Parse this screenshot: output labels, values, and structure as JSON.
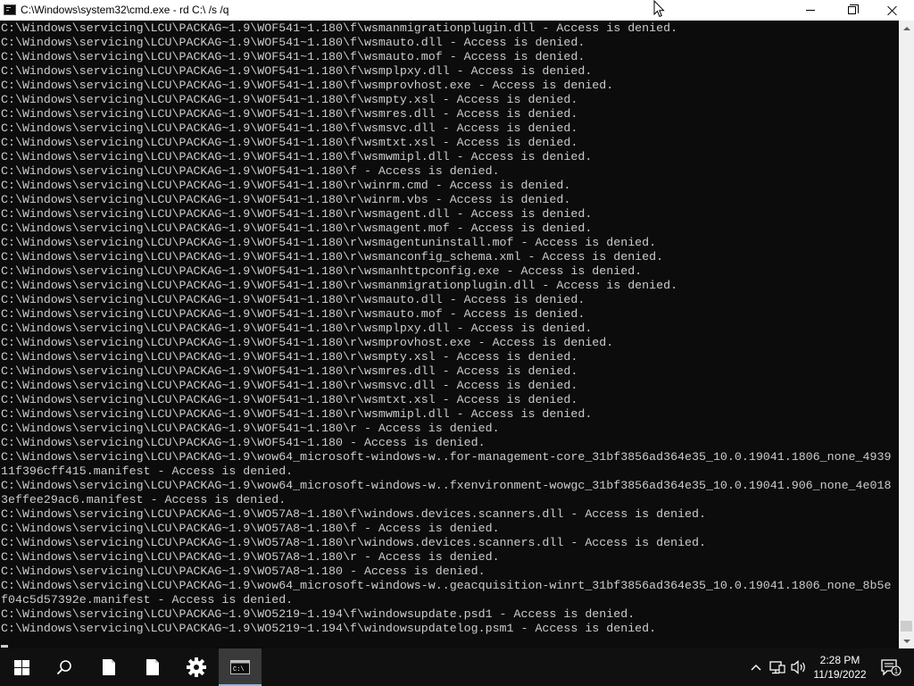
{
  "window": {
    "title": "C:\\Windows\\system32\\cmd.exe - rd  C:\\ /s /q"
  },
  "console": {
    "lines": [
      "C:\\Windows\\servicing\\LCU\\PACKAG~1.9\\WOF541~1.180\\f\\wsmanmigrationplugin.dll - Access is denied.",
      "C:\\Windows\\servicing\\LCU\\PACKAG~1.9\\WOF541~1.180\\f\\wsmauto.dll - Access is denied.",
      "C:\\Windows\\servicing\\LCU\\PACKAG~1.9\\WOF541~1.180\\f\\wsmauto.mof - Access is denied.",
      "C:\\Windows\\servicing\\LCU\\PACKAG~1.9\\WOF541~1.180\\f\\wsmplpxy.dll - Access is denied.",
      "C:\\Windows\\servicing\\LCU\\PACKAG~1.9\\WOF541~1.180\\f\\wsmprovhost.exe - Access is denied.",
      "C:\\Windows\\servicing\\LCU\\PACKAG~1.9\\WOF541~1.180\\f\\wsmpty.xsl - Access is denied.",
      "C:\\Windows\\servicing\\LCU\\PACKAG~1.9\\WOF541~1.180\\f\\wsmres.dll - Access is denied.",
      "C:\\Windows\\servicing\\LCU\\PACKAG~1.9\\WOF541~1.180\\f\\wsmsvc.dll - Access is denied.",
      "C:\\Windows\\servicing\\LCU\\PACKAG~1.9\\WOF541~1.180\\f\\wsmtxt.xsl - Access is denied.",
      "C:\\Windows\\servicing\\LCU\\PACKAG~1.9\\WOF541~1.180\\f\\wsmwmipl.dll - Access is denied.",
      "C:\\Windows\\servicing\\LCU\\PACKAG~1.9\\WOF541~1.180\\f - Access is denied.",
      "C:\\Windows\\servicing\\LCU\\PACKAG~1.9\\WOF541~1.180\\r\\winrm.cmd - Access is denied.",
      "C:\\Windows\\servicing\\LCU\\PACKAG~1.9\\WOF541~1.180\\r\\winrm.vbs - Access is denied.",
      "C:\\Windows\\servicing\\LCU\\PACKAG~1.9\\WOF541~1.180\\r\\wsmagent.dll - Access is denied.",
      "C:\\Windows\\servicing\\LCU\\PACKAG~1.9\\WOF541~1.180\\r\\wsmagent.mof - Access is denied.",
      "C:\\Windows\\servicing\\LCU\\PACKAG~1.9\\WOF541~1.180\\r\\wsmagentuninstall.mof - Access is denied.",
      "C:\\Windows\\servicing\\LCU\\PACKAG~1.9\\WOF541~1.180\\r\\wsmanconfig_schema.xml - Access is denied.",
      "C:\\Windows\\servicing\\LCU\\PACKAG~1.9\\WOF541~1.180\\r\\wsmanhttpconfig.exe - Access is denied.",
      "C:\\Windows\\servicing\\LCU\\PACKAG~1.9\\WOF541~1.180\\r\\wsmanmigrationplugin.dll - Access is denied.",
      "C:\\Windows\\servicing\\LCU\\PACKAG~1.9\\WOF541~1.180\\r\\wsmauto.dll - Access is denied.",
      "C:\\Windows\\servicing\\LCU\\PACKAG~1.9\\WOF541~1.180\\r\\wsmauto.mof - Access is denied.",
      "C:\\Windows\\servicing\\LCU\\PACKAG~1.9\\WOF541~1.180\\r\\wsmplpxy.dll - Access is denied.",
      "C:\\Windows\\servicing\\LCU\\PACKAG~1.9\\WOF541~1.180\\r\\wsmprovhost.exe - Access is denied.",
      "C:\\Windows\\servicing\\LCU\\PACKAG~1.9\\WOF541~1.180\\r\\wsmpty.xsl - Access is denied.",
      "C:\\Windows\\servicing\\LCU\\PACKAG~1.9\\WOF541~1.180\\r\\wsmres.dll - Access is denied.",
      "C:\\Windows\\servicing\\LCU\\PACKAG~1.9\\WOF541~1.180\\r\\wsmsvc.dll - Access is denied.",
      "C:\\Windows\\servicing\\LCU\\PACKAG~1.9\\WOF541~1.180\\r\\wsmtxt.xsl - Access is denied.",
      "C:\\Windows\\servicing\\LCU\\PACKAG~1.9\\WOF541~1.180\\r\\wsmwmipl.dll - Access is denied.",
      "C:\\Windows\\servicing\\LCU\\PACKAG~1.9\\WOF541~1.180\\r - Access is denied.",
      "C:\\Windows\\servicing\\LCU\\PACKAG~1.9\\WOF541~1.180 - Access is denied.",
      "C:\\Windows\\servicing\\LCU\\PACKAG~1.9\\wow64_microsoft-windows-w..for-management-core_31bf3856ad364e35_10.0.19041.1806_none_4939",
      "11f396cff415.manifest - Access is denied.",
      "C:\\Windows\\servicing\\LCU\\PACKAG~1.9\\wow64_microsoft-windows-w..fxenvironment-wowgc_31bf3856ad364e35_10.0.19041.906_none_4e018",
      "3effee29ac6.manifest - Access is denied.",
      "C:\\Windows\\servicing\\LCU\\PACKAG~1.9\\WO57A8~1.180\\f\\windows.devices.scanners.dll - Access is denied.",
      "C:\\Windows\\servicing\\LCU\\PACKAG~1.9\\WO57A8~1.180\\f - Access is denied.",
      "C:\\Windows\\servicing\\LCU\\PACKAG~1.9\\WO57A8~1.180\\r\\windows.devices.scanners.dll - Access is denied.",
      "C:\\Windows\\servicing\\LCU\\PACKAG~1.9\\WO57A8~1.180\\r - Access is denied.",
      "C:\\Windows\\servicing\\LCU\\PACKAG~1.9\\WO57A8~1.180 - Access is denied.",
      "C:\\Windows\\servicing\\LCU\\PACKAG~1.9\\wow64_microsoft-windows-w..geacquisition-winrt_31bf3856ad364e35_10.0.19041.1806_none_8b5e",
      "f04c5d57392e.manifest - Access is denied.",
      "C:\\Windows\\servicing\\LCU\\PACKAG~1.9\\WO5219~1.194\\f\\windowsupdate.psd1 - Access is denied.",
      "C:\\Windows\\servicing\\LCU\\PACKAG~1.9\\WO5219~1.194\\f\\windowsupdatelog.psm1 - Access is denied."
    ]
  },
  "taskbar": {
    "clock_time": "2:28 PM",
    "clock_date": "11/19/2022",
    "notification_count": "1",
    "icons": [
      "windows-start-icon",
      "search-icon",
      "file-icon",
      "file-icon",
      "gear-icon",
      "cmd-icon"
    ]
  },
  "colors": {
    "console_bg": "#0c0c0c",
    "console_fg": "#cccccc",
    "taskbar_bg": "#101010",
    "active_task_underline": "#9ab0d6"
  }
}
